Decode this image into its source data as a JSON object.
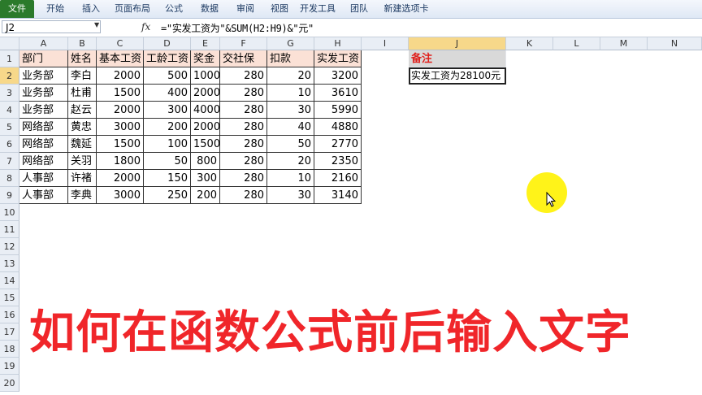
{
  "ribbon": {
    "tabs": [
      "文件",
      "开始",
      "插入",
      "页面布局",
      "公式",
      "数据",
      "审阅",
      "视图",
      "开发工具",
      "团队",
      "新建选项卡"
    ]
  },
  "formula_bar": {
    "name_box": "J2",
    "fx": "fx",
    "formula": "=\"实发工资为\"&SUM(H2:H9)&\"元\""
  },
  "sheet": {
    "columns": [
      "A",
      "B",
      "C",
      "D",
      "E",
      "F",
      "G",
      "H",
      "I",
      "J",
      "K",
      "L",
      "M",
      "N"
    ],
    "rows": [
      "1",
      "2",
      "3",
      "4",
      "5",
      "6",
      "7",
      "8",
      "9",
      "10",
      "11",
      "12",
      "13",
      "14",
      "15",
      "16",
      "17",
      "18",
      "19",
      "20"
    ],
    "table": {
      "headers": [
        "部门",
        "姓名",
        "基本工资",
        "工龄工资",
        "奖金",
        "交社保",
        "扣款",
        "实发工资"
      ],
      "rows": [
        [
          "业务部",
          "李白",
          "2000",
          "500",
          "1000",
          "280",
          "20",
          "3200"
        ],
        [
          "业务部",
          "杜甫",
          "1500",
          "400",
          "2000",
          "280",
          "10",
          "3610"
        ],
        [
          "业务部",
          "赵云",
          "2000",
          "300",
          "4000",
          "280",
          "30",
          "5990"
        ],
        [
          "网络部",
          "黄忠",
          "3000",
          "200",
          "2000",
          "280",
          "40",
          "4880"
        ],
        [
          "网络部",
          "魏延",
          "1500",
          "100",
          "1500",
          "280",
          "50",
          "2770"
        ],
        [
          "网络部",
          "关羽",
          "1800",
          "50",
          "800",
          "280",
          "20",
          "2350"
        ],
        [
          "人事部",
          "许褚",
          "2000",
          "150",
          "300",
          "280",
          "10",
          "2160"
        ],
        [
          "人事部",
          "李典",
          "3000",
          "250",
          "200",
          "280",
          "30",
          "3140"
        ]
      ]
    },
    "note_header": "备注",
    "note_value": "实发工资为28100元"
  },
  "caption": "如何在函数公式前后输入文字",
  "colors": {
    "header_fill": "#fbe1d6",
    "note_header_text": "#e0201c",
    "caption": "#f0262a",
    "cursor_highlight": "#fff200"
  }
}
